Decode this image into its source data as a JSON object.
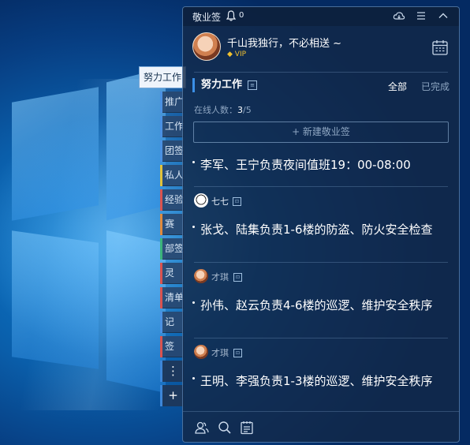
{
  "app": {
    "title": "敬业签",
    "notification_count": "0"
  },
  "profile": {
    "name": "千山我独行，不必相送 ~",
    "badge": "VIP"
  },
  "tabs": {
    "active": "努力工作",
    "items": [
      "推广",
      "工作",
      "团签",
      "私人",
      "经验",
      "赛",
      "部签",
      "灵",
      "清单",
      "记",
      "签"
    ],
    "more_symbol": "⋮",
    "add_symbol": "+"
  },
  "list": {
    "title": "努力工作",
    "filter_all": "全部",
    "filter_done": "已完成",
    "online_label": "在线人数：",
    "online_current": "3",
    "online_total": "/5",
    "new_button": "+ 新建敬业签"
  },
  "notes": [
    {
      "author": "",
      "text": "李军、王宁负责夜间值班19：00-08:00"
    },
    {
      "author": "七七",
      "text": "张戈、陆集负责1-6楼的防盗、防火安全检查"
    },
    {
      "author": "才琪",
      "text": "孙伟、赵云负责4-6楼的巡逻、维护安全秩序"
    },
    {
      "author": "才琪",
      "text": "王明、李强负责1-3楼的巡逻、维护安全秩序"
    }
  ],
  "colors": {
    "accent": "#3b8fe6",
    "vip_gold": "#f2c230",
    "panel_bg": "#12284a",
    "muted_text": "#8ea6c2"
  },
  "icons": {
    "titlebar": [
      "bell-icon",
      "cloud-icon",
      "menu-icon",
      "collapse-icon"
    ],
    "header": [
      "calendar-icon"
    ],
    "bottombar": [
      "contacts-icon",
      "search-icon",
      "notes-icon"
    ]
  }
}
